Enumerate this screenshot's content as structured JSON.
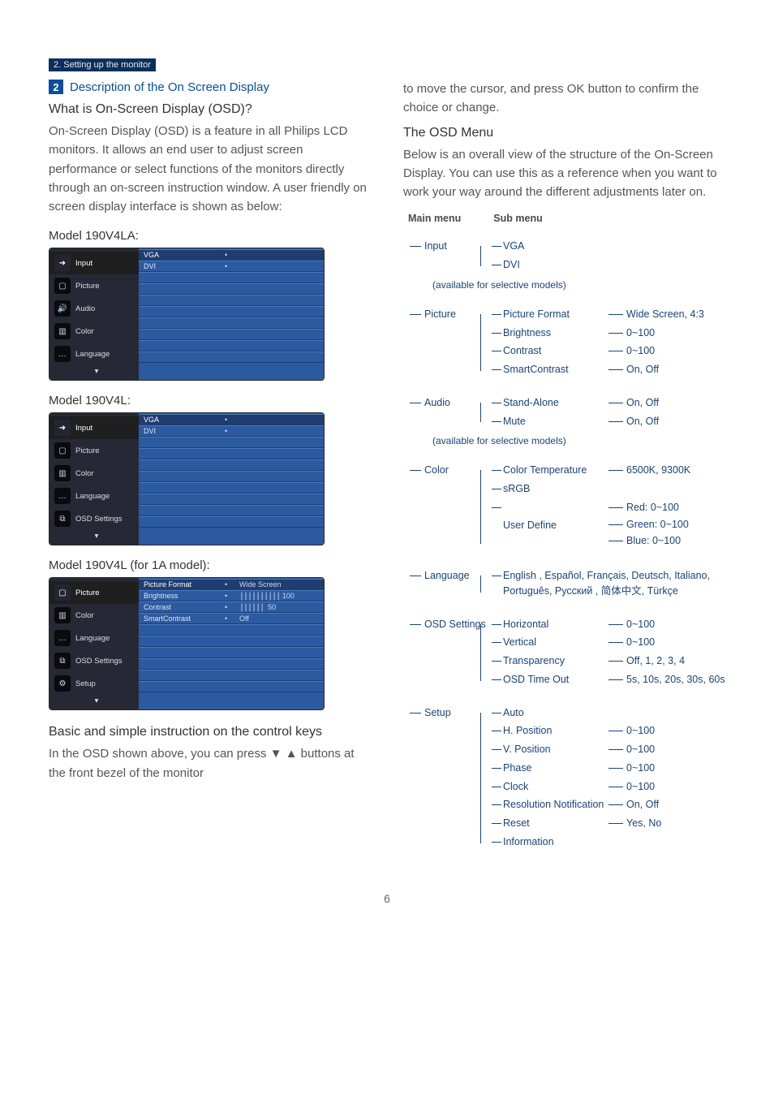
{
  "breadcrumb": "2. Setting up the monitor",
  "section_number": "2",
  "section_title": "Description of the On Screen Display",
  "left": {
    "h_what": "What is On-Screen Display (OSD)?",
    "p_what": "On-Screen Display (OSD) is a feature in all Philips LCD monitors. It allows an end user to adjust screen performance or select functions of the monitors directly through an on-screen instruction window. A user friendly on screen display interface is shown as below:",
    "model1_label": "Model 190V4LA:",
    "model2_label": "Model 190V4L:",
    "model3_label": "Model 190V4L (for 1A model):",
    "osd1": {
      "left_items": [
        "Input",
        "Picture",
        "Audio",
        "Color",
        "Language"
      ],
      "selected": 0,
      "right_rows": [
        {
          "label": "VGA",
          "sel": true
        },
        {
          "label": "DVI"
        },
        {
          "label": ""
        },
        {
          "label": ""
        },
        {
          "label": ""
        },
        {
          "label": ""
        },
        {
          "label": ""
        },
        {
          "label": ""
        },
        {
          "label": ""
        },
        {
          "label": ""
        }
      ]
    },
    "osd2": {
      "left_items": [
        "Input",
        "Picture",
        "Color",
        "Language",
        "OSD Settings"
      ],
      "selected": 0,
      "right_rows": [
        {
          "label": "VGA",
          "sel": true
        },
        {
          "label": "DVI"
        },
        {
          "label": ""
        },
        {
          "label": ""
        },
        {
          "label": ""
        },
        {
          "label": ""
        },
        {
          "label": ""
        },
        {
          "label": ""
        },
        {
          "label": ""
        },
        {
          "label": ""
        }
      ]
    },
    "osd3": {
      "left_items": [
        "Picture",
        "Color",
        "Language",
        "OSD Settings",
        "Setup"
      ],
      "selected": 0,
      "right_rows": [
        {
          "label": "Picture Format",
          "val": "Wide Screen",
          "sel": true
        },
        {
          "label": "Brightness",
          "val_bars": "||||||||||",
          "val_num": "100"
        },
        {
          "label": "Contrast",
          "val_bars": "||||||    ",
          "val_num": "50"
        },
        {
          "label": "SmartContrast",
          "val": "Off"
        },
        {
          "label": ""
        },
        {
          "label": ""
        },
        {
          "label": ""
        },
        {
          "label": ""
        },
        {
          "label": ""
        },
        {
          "label": ""
        }
      ]
    },
    "h_basic": "Basic and simple instruction on the control keys",
    "p_basic": "In the OSD shown above, you can press ▼ ▲ buttons at the front bezel of the monitor"
  },
  "right": {
    "p_cont": "to move the cursor, and press OK button to confirm the choice or change.",
    "h_menu": "The OSD Menu",
    "p_menu": "Below is an overall view of the structure of the On-Screen Display. You can use this as a reference when you want to work your way around the different adjustments later on.",
    "thead_main": "Main menu",
    "thead_sub": "Sub menu",
    "tree": {
      "input": {
        "label": "Input",
        "subs": [
          "VGA",
          "DVI"
        ],
        "note": "(available for selective models)"
      },
      "picture": {
        "label": "Picture",
        "rows": [
          {
            "k": "Picture Format",
            "v": "Wide Screen, 4:3"
          },
          {
            "k": "Brightness",
            "v": "0~100"
          },
          {
            "k": "Contrast",
            "v": "0~100"
          },
          {
            "k": "SmartContrast",
            "v": "On, Off"
          }
        ]
      },
      "audio": {
        "label": "Audio",
        "rows": [
          {
            "k": "Stand-Alone",
            "v": "On, Off"
          },
          {
            "k": "Mute",
            "v": "On, Off"
          }
        ],
        "note": "(available for selective models)"
      },
      "color": {
        "label": "Color",
        "rows": [
          {
            "k": "Color Temperature",
            "v": "6500K, 9300K"
          },
          {
            "k": "sRGB",
            "v": ""
          },
          {
            "k": "User Define",
            "vstack": [
              "Red: 0~100",
              "Green: 0~100",
              "Blue: 0~100"
            ]
          }
        ]
      },
      "language": {
        "label": "Language",
        "text": "English , Español, Français, Deutsch, Italiano, Português, Русский , 简体中文, Türkçe"
      },
      "osd": {
        "label": "OSD Settings",
        "rows": [
          {
            "k": "Horizontal",
            "v": "0~100"
          },
          {
            "k": "Vertical",
            "v": "0~100"
          },
          {
            "k": "Transparency",
            "v": "Off, 1, 2, 3, 4"
          },
          {
            "k": "OSD Time Out",
            "v": "5s, 10s, 20s, 30s, 60s"
          }
        ]
      },
      "setup": {
        "label": "Setup",
        "rows": [
          {
            "k": "Auto",
            "v": ""
          },
          {
            "k": "H. Position",
            "v": "0~100"
          },
          {
            "k": "V. Position",
            "v": "0~100"
          },
          {
            "k": "Phase",
            "v": "0~100"
          },
          {
            "k": "Clock",
            "v": "0~100"
          },
          {
            "k": "Resolution Notification",
            "v": "On, Off"
          },
          {
            "k": "Reset",
            "v": "Yes, No"
          },
          {
            "k": "Information",
            "v": ""
          }
        ]
      }
    }
  },
  "page_number": "6",
  "osd_icons": {
    "Input": "➜",
    "Picture": "▢",
    "Audio": "🔊",
    "Color": "▥",
    "Language": "…",
    "OSD Settings": "⧉",
    "Setup": "⚙"
  }
}
